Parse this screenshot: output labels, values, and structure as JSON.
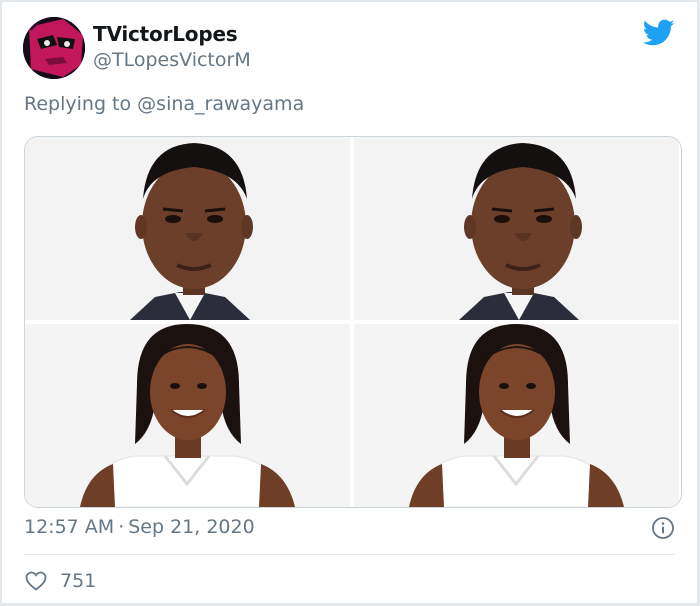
{
  "tweet": {
    "display_name": "TVictorLopes",
    "handle": "@TLopesVictorM",
    "reply_prefix": "Replying to",
    "reply_to": "@sina_rawayama",
    "time": "12:57 AM",
    "separator": "·",
    "date": "Sep 21, 2020",
    "likes": "751"
  },
  "icons": {
    "brand": "twitter-bird-icon",
    "info": "info-icon",
    "like": "heart-icon"
  },
  "colors": {
    "brand_blue": "#1da1f2",
    "secondary_text": "#657786",
    "primary_text": "#14171a"
  }
}
